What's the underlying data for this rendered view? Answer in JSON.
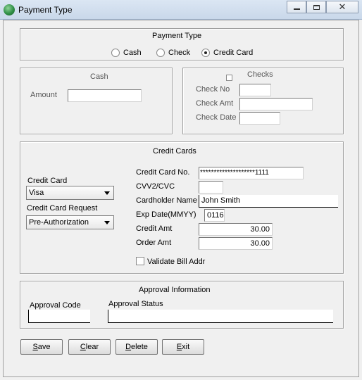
{
  "window": {
    "title": "Payment Type",
    "minimize_icon": "minimize-icon",
    "maximize_icon": "maximize-icon",
    "close_icon": "close-icon"
  },
  "payment_type": {
    "title": "Payment Type",
    "options": [
      {
        "label": "Cash",
        "selected": false
      },
      {
        "label": "Check",
        "selected": false
      },
      {
        "label": "Credit Card",
        "selected": true
      }
    ]
  },
  "cash": {
    "title": "Cash",
    "amount_label": "Amount",
    "amount_value": ""
  },
  "checks": {
    "title": "Checks",
    "check_no_label": "Check No",
    "check_no_value": "",
    "check_amt_label": "Check Amt",
    "check_amt_value": "",
    "check_date_label": "Check Date",
    "check_date_value": ""
  },
  "credit_cards": {
    "title": "Credit Cards",
    "card_label": "Credit Card",
    "card_value": "Visa",
    "request_label": "Credit Card Request",
    "request_value": "Pre-Authorization",
    "card_no_label": "Credit Card No.",
    "card_no_value": "********************1111",
    "cvv_label": "CVV2/CVC",
    "cvv_value": "",
    "holder_label": "Cardholder Name",
    "holder_value": "John Smith",
    "exp_label": "Exp Date(MMYY)",
    "exp_value": "0116",
    "credit_amt_label": "Credit Amt",
    "credit_amt_value": "30.00",
    "order_amt_label": "Order Amt",
    "order_amt_value": "30.00",
    "validate_label": "Validate Bill Addr",
    "validate_checked": false
  },
  "approval": {
    "title": "Approval Information",
    "code_label": "Approval Code",
    "code_value": "",
    "status_label": "Approval Status",
    "status_value": ""
  },
  "buttons": {
    "save_pre": "",
    "save_u": "S",
    "save_post": "ave",
    "clear_pre": "",
    "clear_u": "C",
    "clear_post": "lear",
    "delete_pre": "",
    "delete_u": "D",
    "delete_post": "elete",
    "exit_pre": "",
    "exit_u": "E",
    "exit_post": "xit"
  }
}
